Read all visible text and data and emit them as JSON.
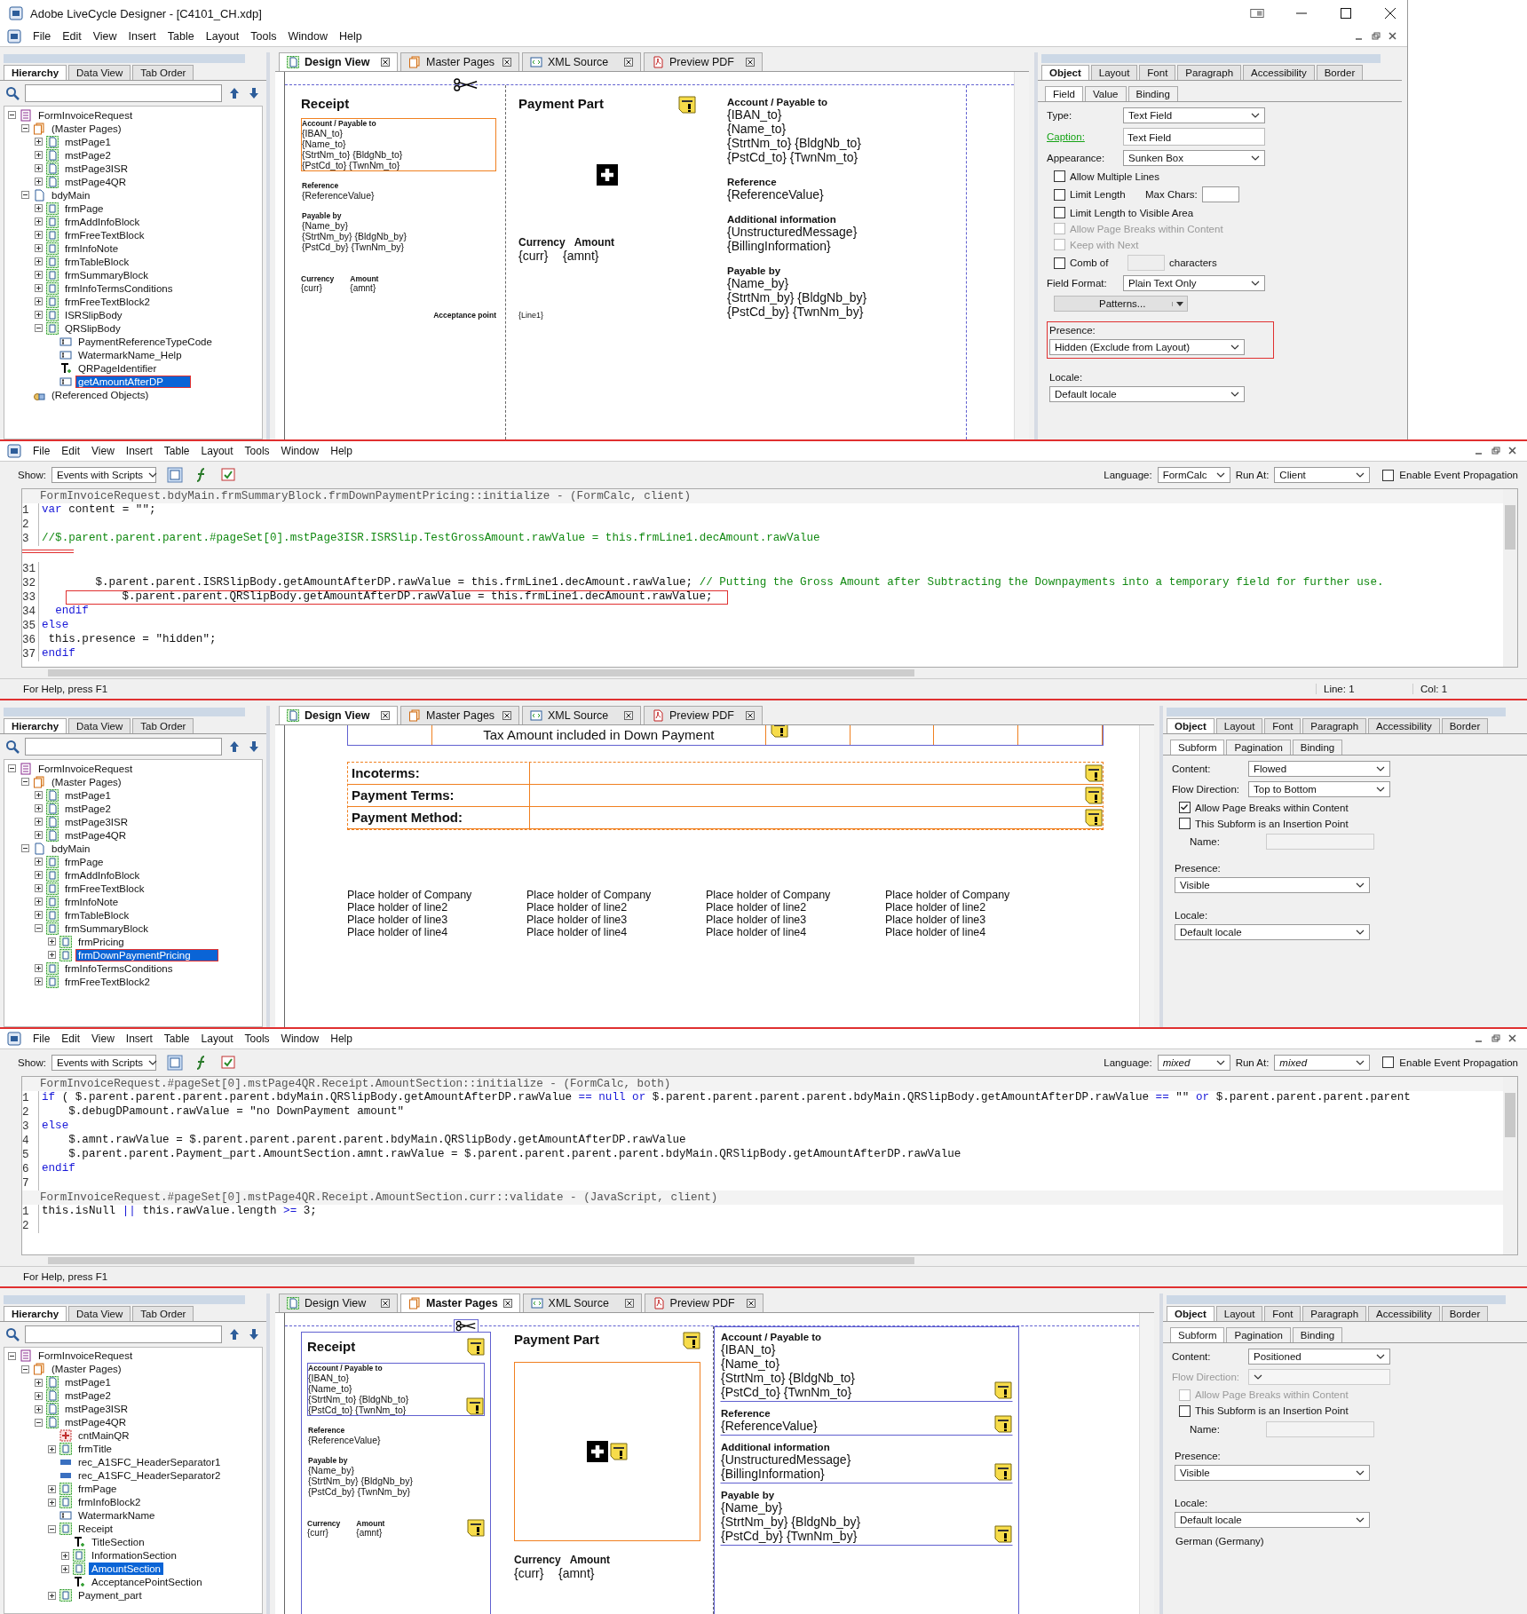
{
  "panels": [
    {
      "kind": "designer",
      "window": {
        "title": "Adobe LiveCycle Designer - [C4101_CH.xdp]"
      },
      "menu": [
        "File",
        "Edit",
        "View",
        "Insert",
        "Table",
        "Layout",
        "Tools",
        "Window",
        "Help"
      ],
      "hierarchy": {
        "tabs": [
          {
            "label": "Hierarchy",
            "selected": true
          },
          {
            "label": "Data View",
            "selected": false
          },
          {
            "label": "Tab Order",
            "selected": false
          }
        ],
        "tree": [
          {
            "label": "FormInvoiceRequest",
            "kind": "form",
            "expanded": true,
            "selected": false,
            "children": [
              {
                "label": "(Master Pages)",
                "kind": "master",
                "expanded": true,
                "selected": false,
                "children": [
                  {
                    "label": "mstPage1",
                    "kind": "page",
                    "expanded": false,
                    "selected": false
                  },
                  {
                    "label": "mstPage2",
                    "kind": "page",
                    "expanded": false,
                    "selected": false
                  },
                  {
                    "label": "mstPage3ISR",
                    "kind": "page",
                    "expanded": false,
                    "selected": false
                  },
                  {
                    "label": "mstPage4QR",
                    "kind": "page",
                    "expanded": false,
                    "selected": false
                  }
                ]
              },
              {
                "label": "bdyMain",
                "kind": "body",
                "expanded": true,
                "selected": false,
                "children": [
                  {
                    "label": "frmPage",
                    "kind": "subform",
                    "expanded": false,
                    "selected": false
                  },
                  {
                    "label": "frmAddInfoBlock",
                    "kind": "subform",
                    "expanded": false,
                    "selected": false
                  },
                  {
                    "label": "frmFreeTextBlock",
                    "kind": "subform",
                    "expanded": false,
                    "selected": false
                  },
                  {
                    "label": "frmInfoNote",
                    "kind": "subform",
                    "expanded": false,
                    "selected": false
                  },
                  {
                    "label": "frmTableBlock",
                    "kind": "subform",
                    "expanded": false,
                    "selected": false
                  },
                  {
                    "label": "frmSummaryBlock",
                    "kind": "subform",
                    "expanded": false,
                    "selected": false
                  },
                  {
                    "label": "frmInfoTermsConditions",
                    "kind": "subform",
                    "expanded": false,
                    "selected": false
                  },
                  {
                    "label": "frmFreeTextBlock2",
                    "kind": "subform",
                    "expanded": false,
                    "selected": false
                  },
                  {
                    "label": "ISRSlipBody",
                    "kind": "subform",
                    "expanded": false,
                    "selected": false
                  },
                  {
                    "label": "QRSlipBody",
                    "kind": "subform",
                    "expanded": true,
                    "selected": false,
                    "children": [
                      {
                        "label": "PaymentReferenceTypeCode",
                        "kind": "textfield",
                        "selected": false
                      },
                      {
                        "label": "WatermarkName_Help",
                        "kind": "textfield",
                        "selected": false
                      },
                      {
                        "label": "QRPageIdentifier",
                        "kind": "text",
                        "selected": false
                      },
                      {
                        "label": "getAmountAfterDP",
                        "kind": "textfield",
                        "selected": true,
                        "highlighted": true
                      }
                    ]
                  }
                ]
              },
              {
                "label": "(Referenced Objects)",
                "kind": "refobj",
                "selected": false
              }
            ]
          }
        ]
      },
      "design": {
        "tabs": [
          {
            "label": "Design View",
            "kind": "page",
            "selected": true
          },
          {
            "label": "Master Pages",
            "kind": "master",
            "selected": false
          },
          {
            "label": "XML Source",
            "kind": "xml",
            "selected": false
          },
          {
            "label": "Preview PDF",
            "kind": "pdf",
            "selected": false
          }
        ],
        "canvas": {
          "kind": "qr_slip",
          "receipt": {
            "title": "Receipt",
            "blocks": [
              {
                "label": "Account / Payable to",
                "lines": [
                  "{IBAN_to}",
                  "{Name_to}",
                  "{StrtNm_to} {BldgNb_to}",
                  "{PstCd_to} {TwnNm_to}"
                ],
                "selected": true
              },
              {
                "label": "Reference",
                "lines": [
                  "{ReferenceValue}"
                ],
                "selected": false
              },
              {
                "label": "Payable by",
                "lines": [
                  "{Name_by}",
                  "{StrtNm_by} {BldgNb_by}",
                  "{PstCd_by} {TwnNm_by}"
                ],
                "selected": false
              }
            ],
            "currency": [
              {
                "label": "Currency",
                "value": "{curr}"
              },
              {
                "label": "Amount",
                "value": "{amnt}"
              }
            ],
            "acceptance": "Acceptance point"
          },
          "payment": {
            "title": "Payment Part",
            "currency": [
              {
                "label": "Currency",
                "value": "{curr}"
              },
              {
                "label": "Amount",
                "value": "{amnt}"
              }
            ],
            "extra_lines": [
              "{Line1}"
            ]
          },
          "info": [
            {
              "label": "Account / Payable to",
              "lines": [
                "{IBAN_to}",
                "{Name_to}",
                "{StrtNm_to} {BldgNb_to}",
                "{PstCd_to} {TwnNm_to}"
              ]
            },
            {
              "label": "Reference",
              "lines": [
                "{ReferenceValue}"
              ]
            },
            {
              "label": "Additional information",
              "lines": [
                "{UnstructuredMessage}",
                "{BillingInformation}"
              ]
            },
            {
              "label": "Payable by",
              "lines": [
                "{Name_by}",
                "{StrtNm_by} {BldgNb_by}",
                "{PstCd_by} {TwnNm_by}"
              ]
            }
          ]
        }
      },
      "object": {
        "tabs": [
          {
            "label": "Object",
            "selected": true
          },
          {
            "label": "Layout",
            "selected": false
          },
          {
            "label": "Font",
            "selected": false
          },
          {
            "label": "Paragraph",
            "selected": false
          },
          {
            "label": "Accessibility",
            "selected": false
          },
          {
            "label": "Border",
            "selected": false
          }
        ],
        "subtabs": [
          {
            "label": "Field",
            "selected": true
          },
          {
            "label": "Value",
            "selected": false
          },
          {
            "label": "Binding",
            "selected": false
          }
        ],
        "properties": [
          {
            "kind": "dropdown",
            "label": "Type:",
            "value": "Text Field",
            "disabled": false
          },
          {
            "kind": "text_field",
            "label": "Caption:",
            "value": "Text Field"
          },
          {
            "kind": "dropdown",
            "label": "Appearance:",
            "value": "Sunken Box",
            "disabled": false
          },
          {
            "kind": "checkbox",
            "label": "Allow Multiple Lines",
            "checked": false,
            "disabled": false
          },
          {
            "kind": "checkbox_with_field",
            "label": "Limit Length",
            "checked": false,
            "field_label": "Max Chars:"
          },
          {
            "kind": "checkbox",
            "label": "Limit Length to Visible Area",
            "checked": false,
            "disabled": false
          },
          {
            "kind": "checkbox",
            "label": "Allow Page Breaks within Content",
            "checked": false,
            "disabled": true
          },
          {
            "kind": "checkbox",
            "label": "Keep with Next",
            "checked": false,
            "disabled": true
          },
          {
            "kind": "comb",
            "label": "Comb of",
            "checked": false,
            "suffix": "characters"
          },
          {
            "kind": "dropdown",
            "label": "Field Format:",
            "value": "Plain Text Only",
            "disabled": false
          },
          {
            "kind": "button",
            "label": "Patterns..."
          },
          {
            "kind": "dropdown_stacked",
            "label": "Presence:",
            "value": "Hidden (Exclude from Layout)",
            "highlighted": true
          },
          {
            "kind": "dropdown_stacked",
            "label": "Locale:",
            "value": "Default locale",
            "highlighted": false
          }
        ]
      }
    },
    {
      "kind": "script_editor",
      "menu": [
        "File",
        "Edit",
        "View",
        "Insert",
        "Table",
        "Layout",
        "Tools",
        "Window",
        "Help"
      ],
      "show": {
        "label": "Show:",
        "value": "Events with Scripts"
      },
      "language": {
        "label": "Language:",
        "value": "FormCalc"
      },
      "run_at": {
        "label": "Run At:",
        "value": "Client"
      },
      "values_mixed": false,
      "propagation": {
        "label": "Enable Event Propagation",
        "checked": false
      },
      "sections": [
        {
          "header": "FormInvoiceRequest.bdyMain.frmSummaryBlock.frmDownPaymentPricing::initialize - (FormCalc, client)",
          "gap_before": false,
          "lines": [
            {
              "number": "1",
              "text": "var content = \"\";",
              "highlighted": false
            },
            {
              "number": "2",
              "highlighted": false
            },
            {
              "number": "3",
              "text": "//$.parent.parent.parent.#pageSet[0].mstPage3ISR.ISRSlip.TestGrossAmount.rawValue = this.frmLine1.decAmount.rawValue",
              "highlighted": false
            }
          ]
        },
        {
          "gap_before": true,
          "lines": [
            {
              "number": "31",
              "highlighted": false
            },
            {
              "number": "32",
              "text": "        $.parent.parent.ISRSlipBody.getAmountAfterDP.rawValue = this.frmLine1.decAmount.rawValue; // Putting the Gross Amount after Subtracting the Downpayments into a temporary field for further use.",
              "highlighted": false
            },
            {
              "number": "33",
              "text": "        $.parent.parent.QRSlipBody.getAmountAfterDP.rawValue = this.frmLine1.decAmount.rawValue;",
              "highlighted": true
            },
            {
              "number": "34",
              "text": "  endif",
              "highlighted": false
            },
            {
              "number": "35",
              "text": "else",
              "highlighted": false
            },
            {
              "number": "36",
              "text": " this.presence = \"hidden\";",
              "highlighted": false
            },
            {
              "number": "37",
              "text": "endif",
              "highlighted": false
            }
          ]
        }
      ],
      "status": {
        "help": "For Help, press F1",
        "line": "Line: 1",
        "col": "Col: 1"
      }
    },
    {
      "kind": "designer",
      "hierarchy": {
        "tabs": [
          {
            "label": "Hierarchy",
            "selected": true
          },
          {
            "label": "Data View",
            "selected": false
          },
          {
            "label": "Tab Order",
            "selected": false
          }
        ],
        "tree": [
          {
            "label": "FormInvoiceRequest",
            "kind": "form",
            "expanded": true,
            "selected": false,
            "children": [
              {
                "label": "(Master Pages)",
                "kind": "master",
                "expanded": true,
                "selected": false,
                "children": [
                  {
                    "label": "mstPage1",
                    "kind": "page",
                    "expanded": false,
                    "selected": false
                  },
                  {
                    "label": "mstPage2",
                    "kind": "page",
                    "expanded": false,
                    "selected": false
                  },
                  {
                    "label": "mstPage3ISR",
                    "kind": "page",
                    "expanded": false,
                    "selected": false
                  },
                  {
                    "label": "mstPage4QR",
                    "kind": "page",
                    "expanded": false,
                    "selected": false
                  }
                ]
              },
              {
                "label": "bdyMain",
                "kind": "body",
                "expanded": true,
                "selected": false,
                "children": [
                  {
                    "label": "frmPage",
                    "kind": "subform",
                    "expanded": false,
                    "selected": false
                  },
                  {
                    "label": "frmAddInfoBlock",
                    "kind": "subform",
                    "expanded": false,
                    "selected": false
                  },
                  {
                    "label": "frmFreeTextBlock",
                    "kind": "subform",
                    "expanded": false,
                    "selected": false
                  },
                  {
                    "label": "frmInfoNote",
                    "kind": "subform",
                    "expanded": false,
                    "selected": false
                  },
                  {
                    "label": "frmTableBlock",
                    "kind": "subform",
                    "expanded": false,
                    "selected": false
                  },
                  {
                    "label": "frmSummaryBlock",
                    "kind": "subform",
                    "expanded": true,
                    "selected": false,
                    "children": [
                      {
                        "label": "frmPricing",
                        "kind": "subform",
                        "expanded": false,
                        "selected": false
                      },
                      {
                        "label": "frmDownPaymentPricing",
                        "kind": "subform",
                        "expanded": false,
                        "selected": true,
                        "highlighted": true
                      }
                    ]
                  },
                  {
                    "label": "frmInfoTermsConditions",
                    "kind": "subform",
                    "expanded": false,
                    "selected": false
                  },
                  {
                    "label": "frmFreeTextBlock2",
                    "kind": "subform",
                    "expanded": false,
                    "selected": false
                  }
                ]
              }
            ]
          }
        ]
      },
      "design": {
        "tabs": [
          {
            "label": "Design View",
            "kind": "page",
            "selected": true
          },
          {
            "label": "Master Pages",
            "kind": "master",
            "selected": false
          },
          {
            "label": "XML Source",
            "kind": "xml",
            "selected": false
          },
          {
            "label": "Preview PDF",
            "kind": "pdf",
            "selected": false
          }
        ],
        "canvas": {
          "kind": "summary",
          "header": "Tax Amount included in Down Payment",
          "rows": [
            "Incoterms:",
            "Payment Terms:",
            "Payment Method:"
          ],
          "placeholders": [
            [
              "Place holder of Company",
              "Place holder of line2",
              "Place holder of line3",
              "Place holder of line4"
            ],
            [
              "Place holder of Company",
              "Place holder of line2",
              "Place holder of line3",
              "Place holder of line4"
            ],
            [
              "Place holder of Company",
              "Place holder of line2",
              "Place holder of line3",
              "Place holder of line4"
            ],
            [
              "Place holder of Company",
              "Place holder of line2",
              "Place holder of line3",
              "Place holder of line4"
            ]
          ]
        }
      },
      "object": {
        "tabs": [
          {
            "label": "Object",
            "selected": true
          },
          {
            "label": "Layout",
            "selected": false
          },
          {
            "label": "Font",
            "selected": false
          },
          {
            "label": "Paragraph",
            "selected": false
          },
          {
            "label": "Accessibility",
            "selected": false
          },
          {
            "label": "Border",
            "selected": false
          }
        ],
        "subtabs": [
          {
            "label": "Subform",
            "selected": true
          },
          {
            "label": "Pagination",
            "selected": false
          },
          {
            "label": "Binding",
            "selected": false
          }
        ],
        "properties": [
          {
            "kind": "dropdown",
            "label": "Content:",
            "value": "Flowed",
            "disabled": false
          },
          {
            "kind": "dropdown",
            "label": "Flow Direction:",
            "value": "Top to Bottom",
            "disabled": false
          },
          {
            "kind": "checkbox",
            "label": "Allow Page Breaks within Content",
            "checked": true,
            "disabled": false
          },
          {
            "kind": "checkbox",
            "label": "This Subform is an Insertion Point",
            "checked": false,
            "disabled": false
          },
          {
            "kind": "name_field",
            "label": "Name:"
          },
          {
            "kind": "dropdown_stacked",
            "label": "Presence:",
            "value": "Visible",
            "highlighted": false
          },
          {
            "kind": "dropdown_stacked",
            "label": "Locale:",
            "value": "Default locale",
            "highlighted": false
          }
        ]
      }
    },
    {
      "kind": "script_editor",
      "menu": [
        "File",
        "Edit",
        "View",
        "Insert",
        "Table",
        "Layout",
        "Tools",
        "Window",
        "Help"
      ],
      "show": {
        "label": "Show:",
        "value": "Events with Scripts"
      },
      "language": {
        "label": "Language:",
        "value": "mixed"
      },
      "run_at": {
        "label": "Run At:",
        "value": "mixed"
      },
      "values_mixed": true,
      "propagation": {
        "label": "Enable Event Propagation",
        "checked": false
      },
      "sections": [
        {
          "header": "FormInvoiceRequest.#pageSet[0].mstPage4QR.Receipt.AmountSection::initialize - (FormCalc, both)",
          "gap_before": false,
          "lines": [
            {
              "number": "1",
              "text": "if ( $.parent.parent.parent.parent.bdyMain.QRSlipBody.getAmountAfterDP.rawValue == null or $.parent.parent.parent.parent.bdyMain.QRSlipBody.getAmountAfterDP.rawValue == \"\" or $.parent.parent.parent.parent",
              "highlighted": false
            },
            {
              "number": "2",
              "text": "    $.debugDPamount.rawValue = \"no DownPayment amount\"",
              "highlighted": false
            },
            {
              "number": "3",
              "text": "else",
              "highlighted": false
            },
            {
              "number": "4",
              "text": "    $.amnt.rawValue = $.parent.parent.parent.parent.bdyMain.QRSlipBody.getAmountAfterDP.rawValue",
              "highlighted": false
            },
            {
              "number": "5",
              "text": "    $.parent.parent.Payment_part.AmountSection.amnt.rawValue = $.parent.parent.parent.parent.bdyMain.QRSlipBody.getAmountAfterDP.rawValue",
              "highlighted": false
            },
            {
              "number": "6",
              "text": "endif",
              "highlighted": false
            },
            {
              "number": "7",
              "highlighted": false
            }
          ]
        },
        {
          "header": "FormInvoiceRequest.#pageSet[0].mstPage4QR.Receipt.AmountSection.curr::validate - (JavaScript, client)",
          "gap_before": false,
          "lines": [
            {
              "number": "1",
              "text": "this.isNull || this.rawValue.length >= 3;",
              "highlighted": false
            },
            {
              "number": "2",
              "highlighted": false
            }
          ]
        }
      ],
      "status": {
        "help": "For Help, press F1"
      }
    },
    {
      "kind": "designer",
      "hierarchy": {
        "tabs": [
          {
            "label": "Hierarchy",
            "selected": true
          },
          {
            "label": "Data View",
            "selected": false
          },
          {
            "label": "Tab Order",
            "selected": false
          }
        ],
        "tree": [
          {
            "label": "FormInvoiceRequest",
            "kind": "form",
            "expanded": true,
            "selected": false,
            "children": [
              {
                "label": "(Master Pages)",
                "kind": "master",
                "expanded": true,
                "selected": false,
                "children": [
                  {
                    "label": "mstPage1",
                    "kind": "page",
                    "expanded": false,
                    "selected": false
                  },
                  {
                    "label": "mstPage2",
                    "kind": "page",
                    "expanded": false,
                    "selected": false
                  },
                  {
                    "label": "mstPage3ISR",
                    "kind": "page",
                    "expanded": false,
                    "selected": false
                  },
                  {
                    "label": "mstPage4QR",
                    "kind": "page",
                    "expanded": true,
                    "selected": false,
                    "children": [
                      {
                        "label": "cntMainQR",
                        "kind": "content",
                        "selected": false
                      },
                      {
                        "label": "frmTitle",
                        "kind": "subform",
                        "expanded": false,
                        "selected": false
                      },
                      {
                        "label": "rec_A1SFC_HeaderSeparator1",
                        "kind": "rect",
                        "selected": false
                      },
                      {
                        "label": "rec_A1SFC_HeaderSeparator2",
                        "kind": "rect",
                        "selected": false
                      },
                      {
                        "label": "frmPage",
                        "kind": "subform",
                        "expanded": false,
                        "selected": false
                      },
                      {
                        "label": "frmInfoBlock2",
                        "kind": "subform",
                        "expanded": false,
                        "selected": false
                      },
                      {
                        "label": "WatermarkName",
                        "kind": "textfield",
                        "selected": false
                      },
                      {
                        "label": "Receipt",
                        "kind": "subform",
                        "expanded": true,
                        "selected": false,
                        "children": [
                          {
                            "label": "TitleSection",
                            "kind": "text",
                            "selected": false
                          },
                          {
                            "label": "InformationSection",
                            "kind": "subform",
                            "expanded": false,
                            "selected": false
                          },
                          {
                            "label": "AmountSection",
                            "kind": "subform",
                            "expanded": false,
                            "selected": true
                          },
                          {
                            "label": "AcceptancePointSection",
                            "kind": "text",
                            "selected": false
                          }
                        ]
                      },
                      {
                        "label": "Payment_part",
                        "kind": "subform",
                        "expanded": false,
                        "selected": false
                      }
                    ]
                  }
                ]
              }
            ]
          }
        ]
      },
      "design": {
        "tabs": [
          {
            "label": "Design View",
            "kind": "page",
            "selected": false
          },
          {
            "label": "Master Pages",
            "kind": "master",
            "selected": true
          },
          {
            "label": "XML Source",
            "kind": "xml",
            "selected": false
          },
          {
            "label": "Preview PDF",
            "kind": "pdf",
            "selected": false
          }
        ],
        "canvas": {
          "kind": "master_slip",
          "receipt": {
            "title": "Receipt",
            "blocks": [
              {
                "label": "Account / Payable to",
                "lines": [
                  "{IBAN_to}",
                  "{Name_to}",
                  "{StrtNm_to} {BldgNb_to}",
                  "{PstCd_to} {TwnNm_to}"
                ],
                "selected": false
              },
              {
                "label": "Reference",
                "lines": [
                  "{ReferenceValue}"
                ],
                "selected": false
              },
              {
                "label": "Payable by",
                "lines": [
                  "{Name_by}",
                  "{StrtNm_by} {BldgNb_by}",
                  "{PstCd_by} {TwnNm_by}"
                ],
                "selected": false
              }
            ],
            "currency": [
              {
                "label": "Currency",
                "value": "{curr}"
              },
              {
                "label": "Amount",
                "value": "{amnt}"
              }
            ]
          },
          "payment": {
            "title": "Payment Part",
            "currency": [
              {
                "label": "Currency",
                "value": "{curr}"
              },
              {
                "label": "Amount",
                "value": "{amnt}"
              }
            ]
          },
          "info": [
            {
              "label": "Account / Payable to",
              "lines": [
                "{IBAN_to}",
                "{Name_to}",
                "{StrtNm_to} {BldgNb_to}",
                "{PstCd_to} {TwnNm_to}"
              ]
            },
            {
              "label": "Reference",
              "lines": [
                "{ReferenceValue}"
              ]
            },
            {
              "label": "Additional information",
              "lines": [
                "{UnstructuredMessage}",
                "{BillingInformation}"
              ]
            },
            {
              "label": "Payable by",
              "lines": [
                "{Name_by}",
                "{StrtNm_by} {BldgNb_by}",
                "{PstCd_by} {TwnNm_by}"
              ]
            }
          ]
        }
      },
      "object": {
        "tabs": [
          {
            "label": "Object",
            "selected": true
          },
          {
            "label": "Layout",
            "selected": false
          },
          {
            "label": "Font",
            "selected": false
          },
          {
            "label": "Paragraph",
            "selected": false
          },
          {
            "label": "Accessibility",
            "selected": false
          },
          {
            "label": "Border",
            "selected": false
          }
        ],
        "subtabs": [
          {
            "label": "Subform",
            "selected": true
          },
          {
            "label": "Pagination",
            "selected": false
          },
          {
            "label": "Binding",
            "selected": false
          }
        ],
        "properties": [
          {
            "kind": "dropdown",
            "label": "Content:",
            "value": "Positioned",
            "disabled": false
          },
          {
            "kind": "dropdown",
            "label": "Flow Direction:",
            "disabled": true
          },
          {
            "kind": "checkbox",
            "label": "Allow Page Breaks within Content",
            "checked": false,
            "disabled": true
          },
          {
            "kind": "checkbox",
            "label": "This Subform is an Insertion Point",
            "checked": false,
            "disabled": false
          },
          {
            "kind": "name_field",
            "label": "Name:"
          },
          {
            "kind": "dropdown_stacked",
            "label": "Presence:",
            "value": "Visible",
            "highlighted": false
          },
          {
            "kind": "dropdown_stacked",
            "label": "Locale:",
            "value": "Default locale",
            "highlighted": false
          },
          {
            "kind": "note",
            "label": "German (Germany)"
          }
        ]
      }
    }
  ]
}
